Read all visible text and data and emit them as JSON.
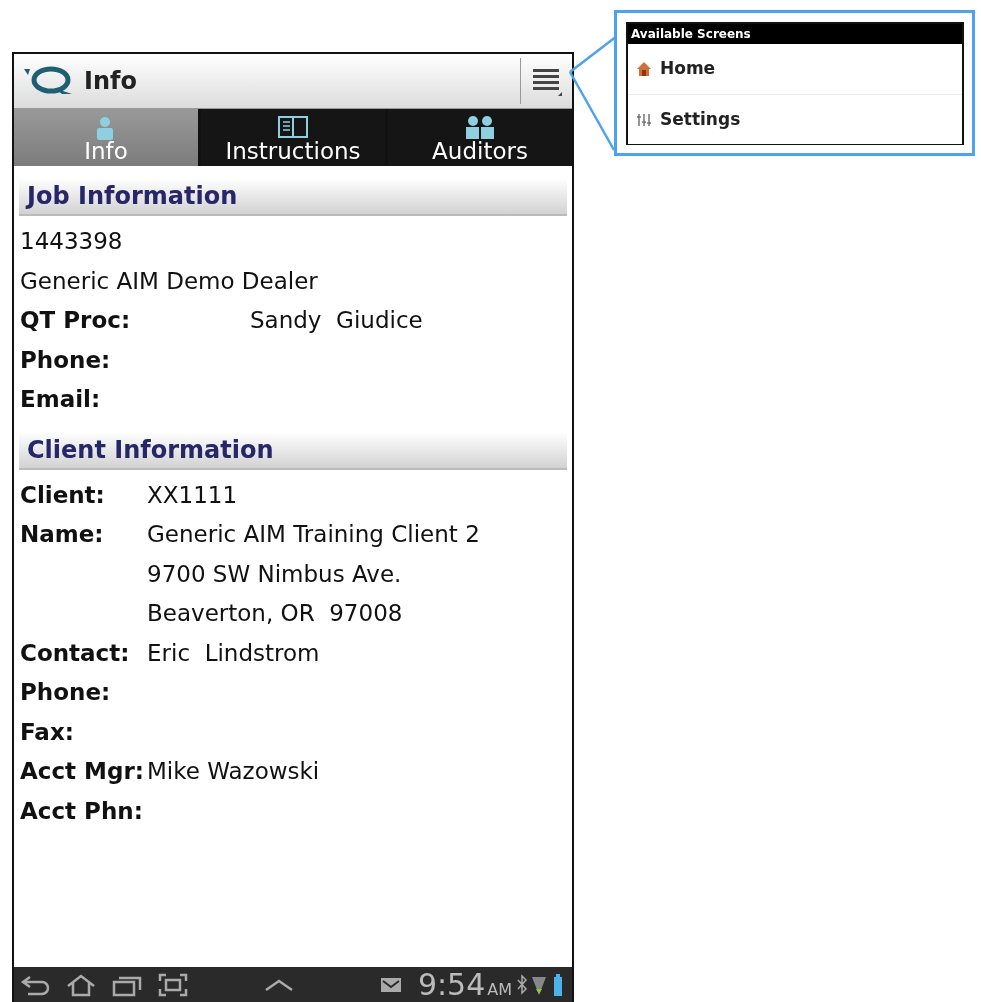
{
  "app_bar": {
    "title": "Info"
  },
  "tabs": [
    {
      "label": "Info",
      "selected": true
    },
    {
      "label": "Instructions",
      "selected": false
    },
    {
      "label": "Auditors",
      "selected": false
    }
  ],
  "sections": [
    {
      "heading": "Job Information",
      "rows": [
        {
          "lines": [
            "1443398"
          ]
        },
        {
          "lines": [
            "Generic AIM Demo Dealer"
          ]
        },
        {
          "label": "QT Proc:",
          "lines": [
            "Sandy  Giudice"
          ]
        },
        {
          "label": "Phone:"
        },
        {
          "label": "Email:"
        }
      ]
    },
    {
      "heading": "Client Information",
      "rows": [
        {
          "label": "Client:",
          "lines": [
            "XX1111"
          ]
        },
        {
          "label": "Name:",
          "lines": [
            "Generic AIM Training Client 2",
            "9700 SW Nimbus Ave.",
            "Beaverton, OR  97008"
          ]
        },
        {
          "label": "Contact:",
          "lines": [
            "Eric  Lindstrom"
          ]
        },
        {
          "label": "Phone:"
        },
        {
          "label": "Fax:"
        },
        {
          "label": "Acct Mgr:",
          "lines": [
            "Mike Wazowski"
          ]
        },
        {
          "label": "Acct Phn:"
        }
      ]
    }
  ],
  "status_bar": {
    "time": "9:54",
    "meridiem": "AM"
  },
  "menu": {
    "title": "Available Screens",
    "items": [
      {
        "label": "Home"
      },
      {
        "label": "Settings"
      }
    ]
  }
}
